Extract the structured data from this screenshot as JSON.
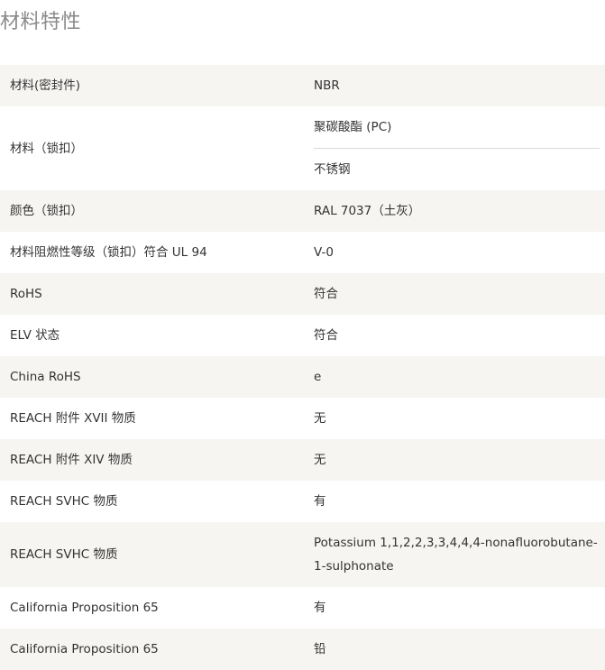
{
  "title": "材料特性",
  "rows": [
    {
      "label": "材料(密封件)",
      "values": [
        "NBR"
      ]
    },
    {
      "label": "材料（锁扣）",
      "values": [
        "聚碳酸酯 (PC)",
        "不锈钢"
      ]
    },
    {
      "label": "颜色（锁扣）",
      "values": [
        "RAL 7037（土灰）"
      ]
    },
    {
      "label": "材料阻燃性等级（锁扣）符合 UL 94",
      "values": [
        "V-0"
      ]
    },
    {
      "label": "RoHS",
      "values": [
        "符合"
      ]
    },
    {
      "label": "ELV 状态",
      "values": [
        "符合"
      ]
    },
    {
      "label": "China RoHS",
      "values": [
        "e"
      ]
    },
    {
      "label": "REACH 附件 XVII 物质",
      "values": [
        "无"
      ]
    },
    {
      "label": "REACH 附件 XIV 物质",
      "values": [
        "无"
      ]
    },
    {
      "label": "REACH SVHC 物质",
      "values": [
        "有"
      ]
    },
    {
      "label": "REACH SVHC 物质",
      "values": [
        "Potassium 1,1,2,2,3,3,4,4,4-nonafluorobutane-1-sulphonate"
      ]
    },
    {
      "label": "California Proposition 65",
      "values": [
        "有"
      ]
    },
    {
      "label": "California Proposition 65",
      "values": [
        "铅"
      ]
    }
  ]
}
